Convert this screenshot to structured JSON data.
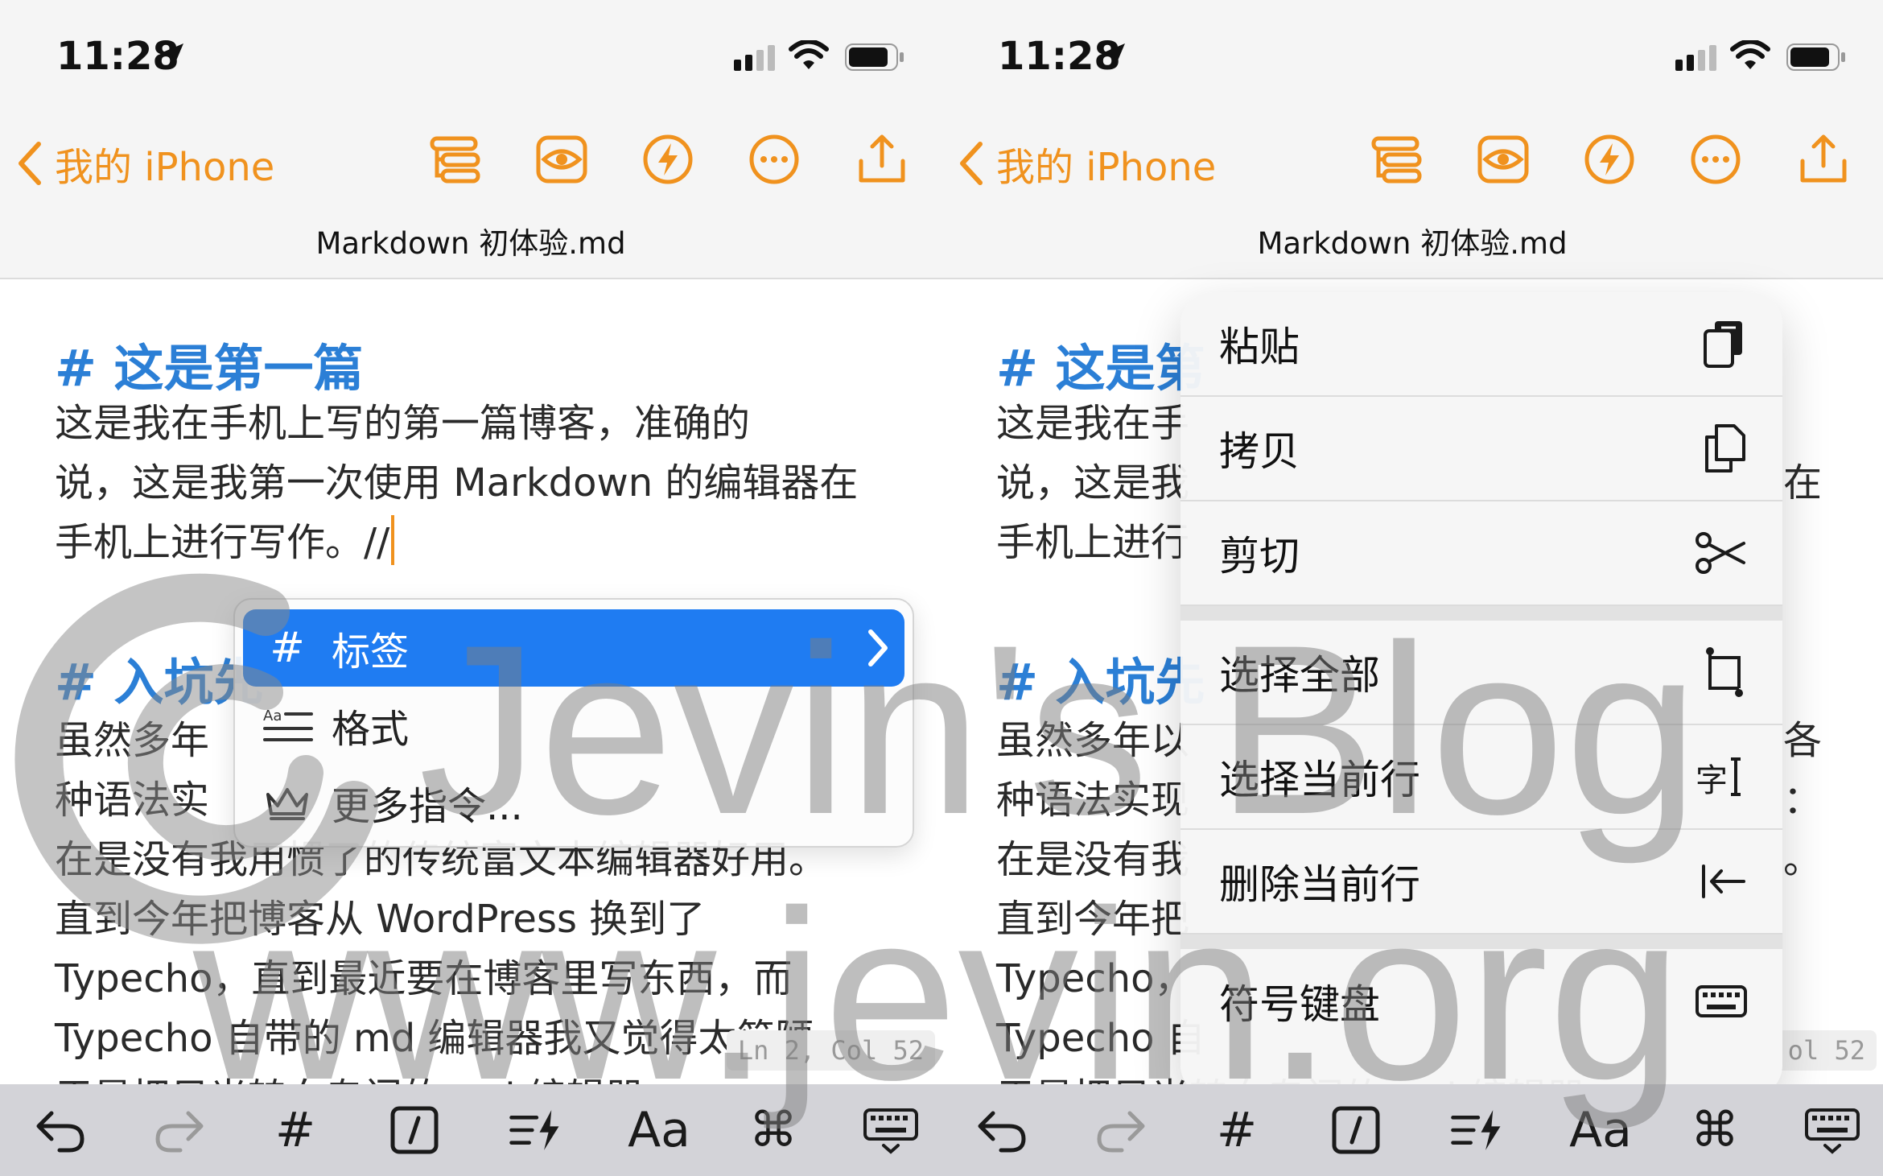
{
  "status_bar": {
    "time": "11:28"
  },
  "nav": {
    "back_label": "我的 iPhone",
    "filename": "Markdown 初体验.md"
  },
  "editor": {
    "heading1": "# 这是第一篇",
    "para1_line1": "这是我在手机上写的第一篇博客，准确的",
    "para1_line2": "说，这是我第一次使用 Markdown 的编辑器在",
    "para1_line3": "手机上进行写作。//",
    "heading2": "# 入坑先",
    "para2_line1": "虽然多年",
    "para2_line2": "种语法实",
    "para2_line3": "在是没有我用惯了的传统富文本编辑器好用。",
    "para2_line4": "直到今年把博客从 WordPress 换到了",
    "para2_line5": "Typecho，直到最近要在博客里写东西，而",
    "para2_line6": "Typecho 自带的 md 编辑器我又觉得太简陋",
    "para2_line7": "于是把目光转向专门的 md 编辑器",
    "position_indicator": "Ln 2, Col 52"
  },
  "right_editor": {
    "heading1": "# 这是第",
    "line1": "这是我在手",
    "line2": "说，这是我",
    "line2_tail": "在",
    "line3": "手机上进行",
    "heading2": "# 入坑先",
    "line4": "虽然多年以",
    "line4_tail": "各",
    "line5": "种语法实现",
    "line5_tail": "：",
    "line6": "在是没有我",
    "line6_tail": "。",
    "line7": "直到今年把",
    "line8": "Typecho，",
    "line9": "Typecho 自",
    "line10": "于是把目光转向专门的 md 编辑器",
    "position_indicator": "ol 52"
  },
  "command_popup": {
    "items": [
      {
        "icon": "#",
        "label": "标签"
      },
      {
        "icon": "Aa",
        "label": "格式"
      },
      {
        "icon": "crown",
        "label": "更多指令..."
      }
    ]
  },
  "context_menu": {
    "items": [
      {
        "label": "粘贴",
        "icon": "paste-icon"
      },
      {
        "label": "拷贝",
        "icon": "copy-icon"
      },
      {
        "label": "剪切",
        "icon": "scissors-icon"
      },
      {
        "label": "选择全部",
        "icon": "select-all-icon"
      },
      {
        "label": "选择当前行",
        "icon": "select-line-icon"
      },
      {
        "label": "删除当前行",
        "icon": "delete-line-icon"
      },
      {
        "label": "符号键盘",
        "icon": "keyboard-icon"
      }
    ]
  },
  "keyboard_bar": {
    "hash": "#",
    "aa": "Aa",
    "cmd": "⌘"
  },
  "watermark": {
    "line1": "Jevin's Blog",
    "line2": "www.jevin.org"
  },
  "colors": {
    "accent": "#f0921e",
    "heading": "#2b7fd6",
    "selection": "#1f7cf2"
  }
}
